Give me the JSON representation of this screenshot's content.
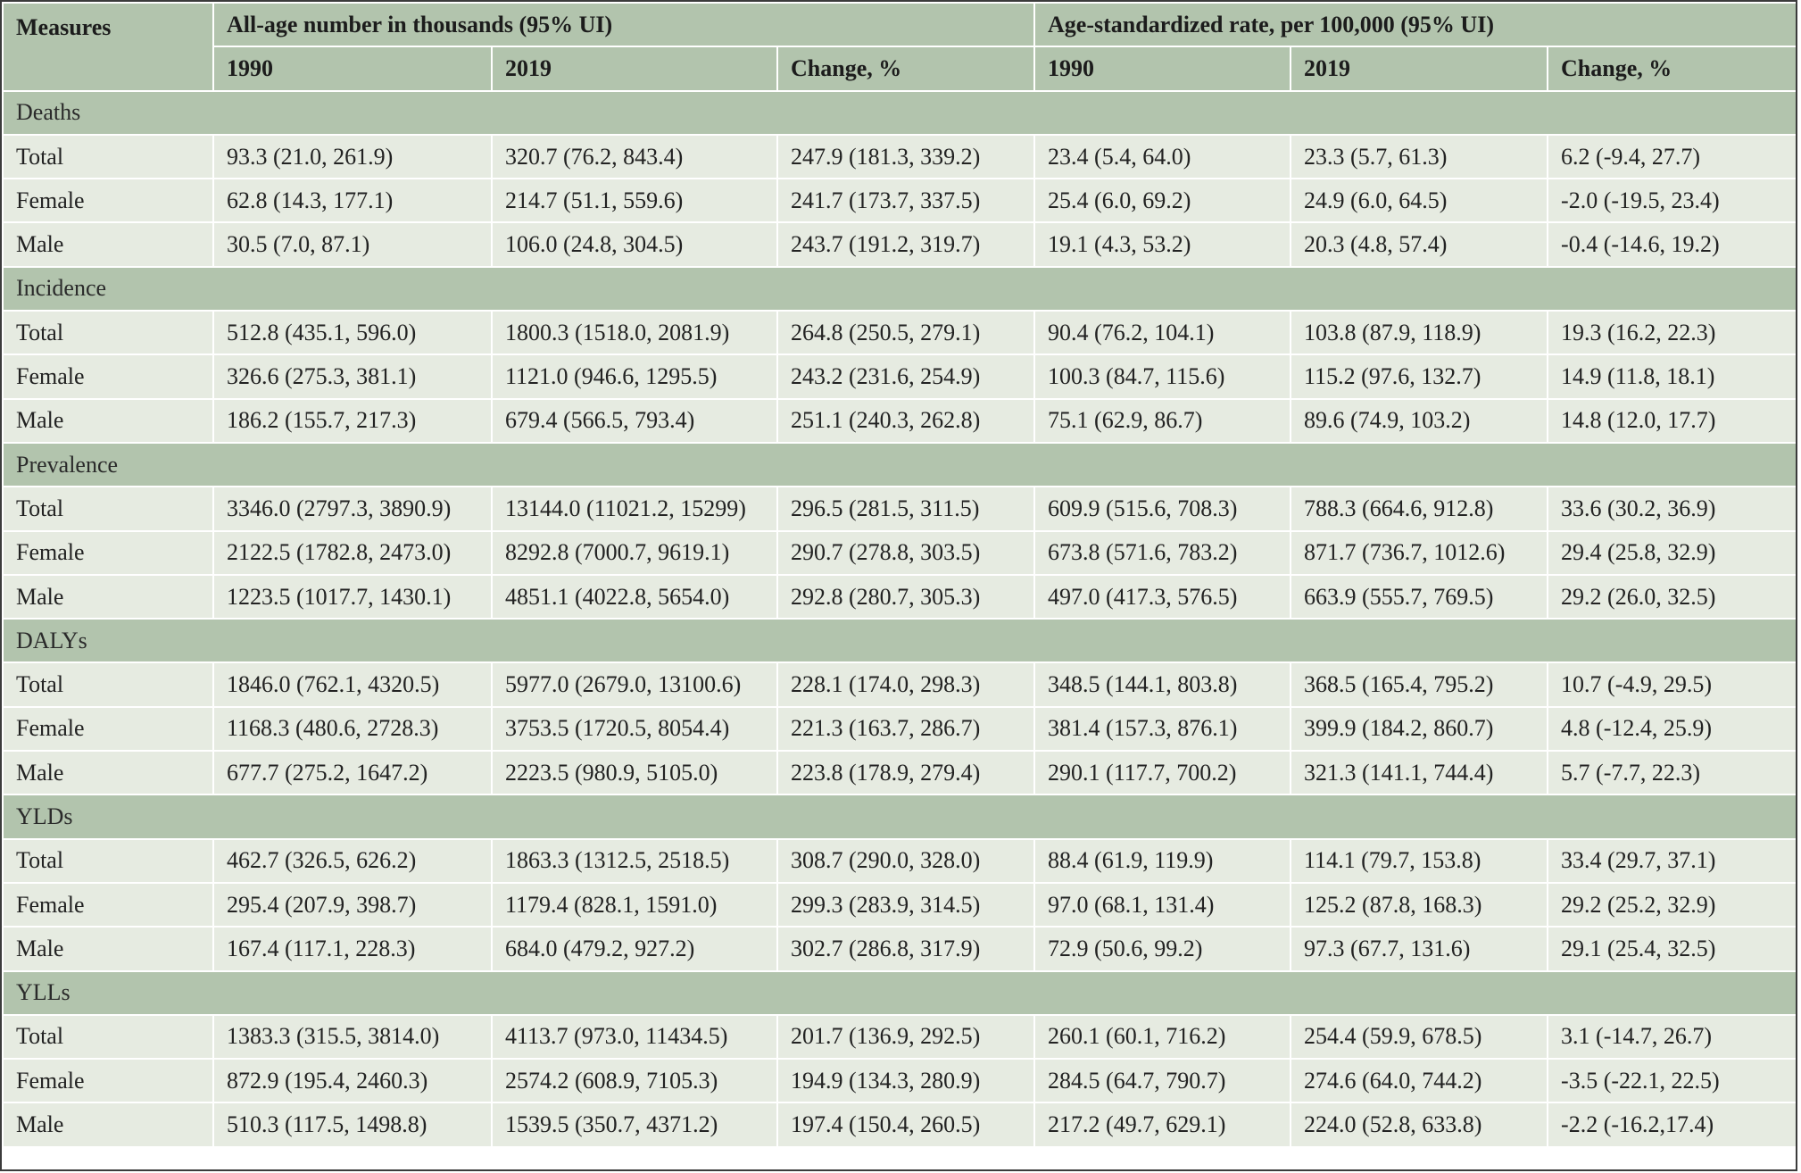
{
  "header": {
    "measures": "Measures",
    "group_number": "All-age number in thousands (95% UI)",
    "group_rate": "Age-standardized rate, per 100,000 (95% UI)",
    "columns": [
      "1990",
      "2019",
      "Change, %",
      "1990",
      "2019",
      "Change, %"
    ]
  },
  "sections": [
    {
      "name": "Deaths",
      "rows": [
        {
          "label": "Total",
          "values": [
            "93.3 (21.0, 261.9)",
            "320.7 (76.2, 843.4)",
            "247.9 (181.3, 339.2)",
            "23.4 (5.4, 64.0)",
            "23.3 (5.7, 61.3)",
            "6.2 (-9.4, 27.7)"
          ]
        },
        {
          "label": "Female",
          "values": [
            "62.8 (14.3, 177.1)",
            "214.7 (51.1, 559.6)",
            "241.7 (173.7, 337.5)",
            "25.4 (6.0, 69.2)",
            "24.9 (6.0, 64.5)",
            "-2.0 (-19.5, 23.4)"
          ]
        },
        {
          "label": "Male",
          "values": [
            "30.5 (7.0, 87.1)",
            "106.0 (24.8, 304.5)",
            "243.7 (191.2, 319.7)",
            "19.1 (4.3, 53.2)",
            "20.3 (4.8, 57.4)",
            "-0.4 (-14.6, 19.2)"
          ]
        }
      ]
    },
    {
      "name": "Incidence",
      "rows": [
        {
          "label": "Total",
          "values": [
            "512.8 (435.1, 596.0)",
            "1800.3 (1518.0, 2081.9)",
            "264.8 (250.5, 279.1)",
            "90.4 (76.2, 104.1)",
            "103.8 (87.9, 118.9)",
            "19.3 (16.2, 22.3)"
          ]
        },
        {
          "label": "Female",
          "values": [
            "326.6 (275.3, 381.1)",
            "1121.0 (946.6, 1295.5)",
            "243.2 (231.6, 254.9)",
            "100.3 (84.7, 115.6)",
            "115.2 (97.6, 132.7)",
            "14.9 (11.8, 18.1)"
          ]
        },
        {
          "label": "Male",
          "values": [
            "186.2 (155.7, 217.3)",
            "679.4 (566.5, 793.4)",
            "251.1 (240.3, 262.8)",
            "75.1 (62.9, 86.7)",
            "89.6 (74.9, 103.2)",
            "14.8 (12.0, 17.7)"
          ]
        }
      ]
    },
    {
      "name": "Prevalence",
      "rows": [
        {
          "label": "Total",
          "values": [
            "3346.0 (2797.3, 3890.9)",
            "13144.0 (11021.2, 15299)",
            "296.5 (281.5, 311.5)",
            "609.9 (515.6, 708.3)",
            "788.3 (664.6, 912.8)",
            "33.6 (30.2, 36.9)"
          ]
        },
        {
          "label": "Female",
          "values": [
            "2122.5 (1782.8, 2473.0)",
            "8292.8 (7000.7, 9619.1)",
            "290.7 (278.8, 303.5)",
            "673.8 (571.6, 783.2)",
            "871.7 (736.7, 1012.6)",
            "29.4 (25.8, 32.9)"
          ]
        },
        {
          "label": "Male",
          "values": [
            "1223.5 (1017.7, 1430.1)",
            "4851.1 (4022.8, 5654.0)",
            "292.8 (280.7, 305.3)",
            "497.0 (417.3, 576.5)",
            "663.9 (555.7, 769.5)",
            "29.2 (26.0, 32.5)"
          ]
        }
      ]
    },
    {
      "name": "DALYs",
      "rows": [
        {
          "label": "Total",
          "values": [
            "1846.0 (762.1, 4320.5)",
            "5977.0 (2679.0, 13100.6)",
            "228.1 (174.0, 298.3)",
            "348.5 (144.1, 803.8)",
            "368.5 (165.4, 795.2)",
            "10.7 (-4.9, 29.5)"
          ]
        },
        {
          "label": "Female",
          "values": [
            "1168.3 (480.6, 2728.3)",
            "3753.5 (1720.5, 8054.4)",
            "221.3 (163.7, 286.7)",
            "381.4 (157.3, 876.1)",
            "399.9 (184.2, 860.7)",
            "4.8 (-12.4, 25.9)"
          ]
        },
        {
          "label": "Male",
          "values": [
            "677.7 (275.2, 1647.2)",
            "2223.5 (980.9, 5105.0)",
            "223.8 (178.9, 279.4)",
            "290.1 (117.7, 700.2)",
            "321.3 (141.1, 744.4)",
            "5.7 (-7.7, 22.3)"
          ]
        }
      ]
    },
    {
      "name": "YLDs",
      "rows": [
        {
          "label": "Total",
          "values": [
            "462.7 (326.5, 626.2)",
            "1863.3 (1312.5, 2518.5)",
            "308.7 (290.0, 328.0)",
            "88.4 (61.9, 119.9)",
            "114.1 (79.7, 153.8)",
            "33.4 (29.7, 37.1)"
          ]
        },
        {
          "label": "Female",
          "values": [
            "295.4 (207.9, 398.7)",
            "1179.4 (828.1, 1591.0)",
            "299.3 (283.9, 314.5)",
            "97.0 (68.1, 131.4)",
            "125.2 (87.8, 168.3)",
            "29.2 (25.2, 32.9)"
          ]
        },
        {
          "label": "Male",
          "values": [
            "167.4 (117.1, 228.3)",
            "684.0 (479.2, 927.2)",
            "302.7 (286.8, 317.9)",
            "72.9 (50.6, 99.2)",
            "97.3 (67.7, 131.6)",
            "29.1 (25.4, 32.5)"
          ]
        }
      ]
    },
    {
      "name": "YLLs",
      "rows": [
        {
          "label": "Total",
          "values": [
            "1383.3 (315.5, 3814.0)",
            "4113.7 (973.0, 11434.5)",
            "201.7 (136.9, 292.5)",
            "260.1 (60.1, 716.2)",
            "254.4 (59.9, 678.5)",
            "3.1 (-14.7, 26.7)"
          ]
        },
        {
          "label": "Female",
          "values": [
            "872.9 (195.4, 2460.3)",
            "2574.2 (608.9, 7105.3)",
            "194.9 (134.3, 280.9)",
            "284.5 (64.7, 790.7)",
            "274.6 (64.0, 744.2)",
            "-3.5 (-22.1, 22.5)"
          ]
        },
        {
          "label": "Male",
          "values": [
            "510.3 (117.5, 1498.8)",
            "1539.5 (350.7, 4371.2)",
            "197.4 (150.4, 260.5)",
            "217.2 (49.7, 629.1)",
            "224.0 (52.8, 633.8)",
            "-2.2 (-16.2,17.4)"
          ]
        }
      ]
    }
  ],
  "colors": {
    "header_bg": "#b2c4ad",
    "row_bg": "#e6ebe1",
    "grid_line": "#ffffff",
    "text": "#222222"
  }
}
